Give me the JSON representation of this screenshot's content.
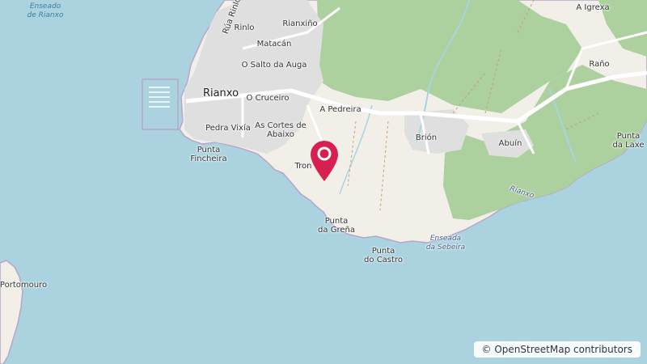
{
  "map": {
    "labels": {
      "enseado_rianxo": "Enseado\nde Rianxo",
      "rua_rinlo": "Rúa Rinlo",
      "rinlo": "Rinlo",
      "rianxino": "Rianxiño",
      "matacan": "Matacán",
      "o_salto": "O Salto da Auga",
      "rianxo": "Rianxo",
      "o_cruceiro": "O Cruceiro",
      "a_pedreira": "A Pedreira",
      "pedra_vixia": "Pedra Vixía",
      "as_cortes": "As Cortes de\nAbaixo",
      "punta_fincheira": "Punta\nFincheira",
      "tronco": "Tron",
      "brion": "Brión",
      "abuin": "Abuín",
      "a_igrexa": "A Igrexa",
      "rano": "Raño",
      "punta_laxe": "Punta\nda Laxe",
      "rianxo_road": "Rianxo",
      "punta_grena": "Punta\nda Greña",
      "punta_castro": "Punta\ndo Castro",
      "enseada_sebeira": "Enseada\nda Sebeira",
      "portomouro": "Portomouro"
    },
    "marker": {
      "icon": "map-pin-icon",
      "color": "#d6204f"
    },
    "colors": {
      "water": "#aad3df",
      "land": "#f2efe9",
      "forest": "#add19e",
      "urban": "#e0dfdf",
      "road": "#ffffff"
    }
  },
  "attribution": {
    "text": "© OpenStreetMap contributors"
  }
}
